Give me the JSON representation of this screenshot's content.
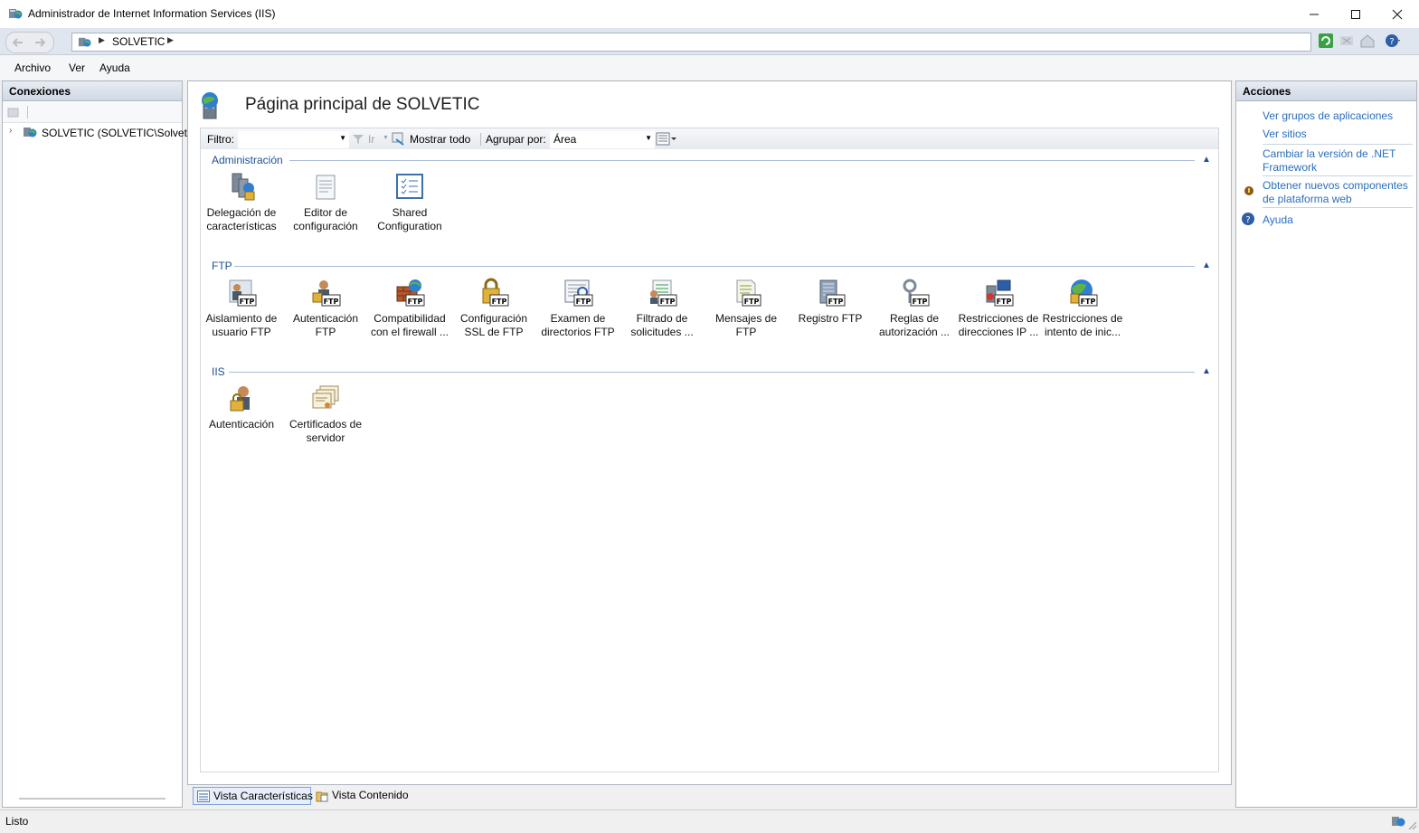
{
  "window": {
    "title": "Administrador de Internet Information Services (IIS)",
    "controls": [
      "minimize",
      "maximize",
      "close"
    ]
  },
  "address_bar": {
    "breadcrumb": [
      "SOLVETIC"
    ]
  },
  "menu": [
    "Archivo",
    "Ver",
    "Ayuda"
  ],
  "connections": {
    "header": "Conexiones",
    "tree_node": "SOLVETIC (SOLVETIC\\Solvetic)"
  },
  "main": {
    "title": "Página principal de SOLVETIC",
    "filter": {
      "label": "Filtro:",
      "value": "",
      "go_label": "Ir",
      "show_all_label": "Mostrar todo",
      "group_by_label": "Agrupar por:",
      "group_by_value": "Área"
    },
    "groups": [
      {
        "name": "Administración",
        "features": [
          {
            "label": "Delegación de características",
            "icon": "delegation-icon"
          },
          {
            "label": "Editor de configuración",
            "icon": "config-editor-icon"
          },
          {
            "label": "Shared Configuration",
            "icon": "shared-config-icon"
          }
        ]
      },
      {
        "name": "FTP",
        "features": [
          {
            "label": "Aislamiento de usuario FTP",
            "icon": "ftp-user-isolation-icon"
          },
          {
            "label": "Autenticación FTP",
            "icon": "ftp-auth-icon"
          },
          {
            "label": "Compatibilidad con el firewall ...",
            "icon": "ftp-firewall-icon"
          },
          {
            "label": "Configuración SSL de FTP",
            "icon": "ftp-ssl-icon"
          },
          {
            "label": "Examen de directorios FTP",
            "icon": "ftp-directory-browsing-icon"
          },
          {
            "label": "Filtrado de solicitudes ...",
            "icon": "ftp-request-filtering-icon"
          },
          {
            "label": "Mensajes de FTP",
            "icon": "ftp-messages-icon"
          },
          {
            "label": "Registro FTP",
            "icon": "ftp-logging-icon"
          },
          {
            "label": "Reglas de autorización ...",
            "icon": "ftp-authorization-icon"
          },
          {
            "label": "Restricciones de direcciones IP ...",
            "icon": "ftp-ip-restrictions-icon"
          },
          {
            "label": "Restricciones de intento de inic...",
            "icon": "ftp-logon-attempt-icon"
          }
        ]
      },
      {
        "name": "IIS",
        "features": [
          {
            "label": "Autenticación",
            "icon": "authentication-icon"
          },
          {
            "label": "Certificados de servidor",
            "icon": "server-certificates-icon"
          }
        ]
      }
    ],
    "view_tabs": {
      "features": "Vista Características",
      "content": "Vista Contenido",
      "selected": "features"
    }
  },
  "actions": {
    "header": "Acciones",
    "items": [
      "Ver grupos de aplicaciones",
      "Ver sitios",
      "Cambiar la versión de .NET Framework",
      "Obtener nuevos componentes de plataforma web",
      "Ayuda"
    ]
  },
  "status": {
    "text": "Listo"
  },
  "colors": {
    "link": "#2a6ebd",
    "group_label": "#1f4f96",
    "pane_border": "#aeb6c1"
  }
}
